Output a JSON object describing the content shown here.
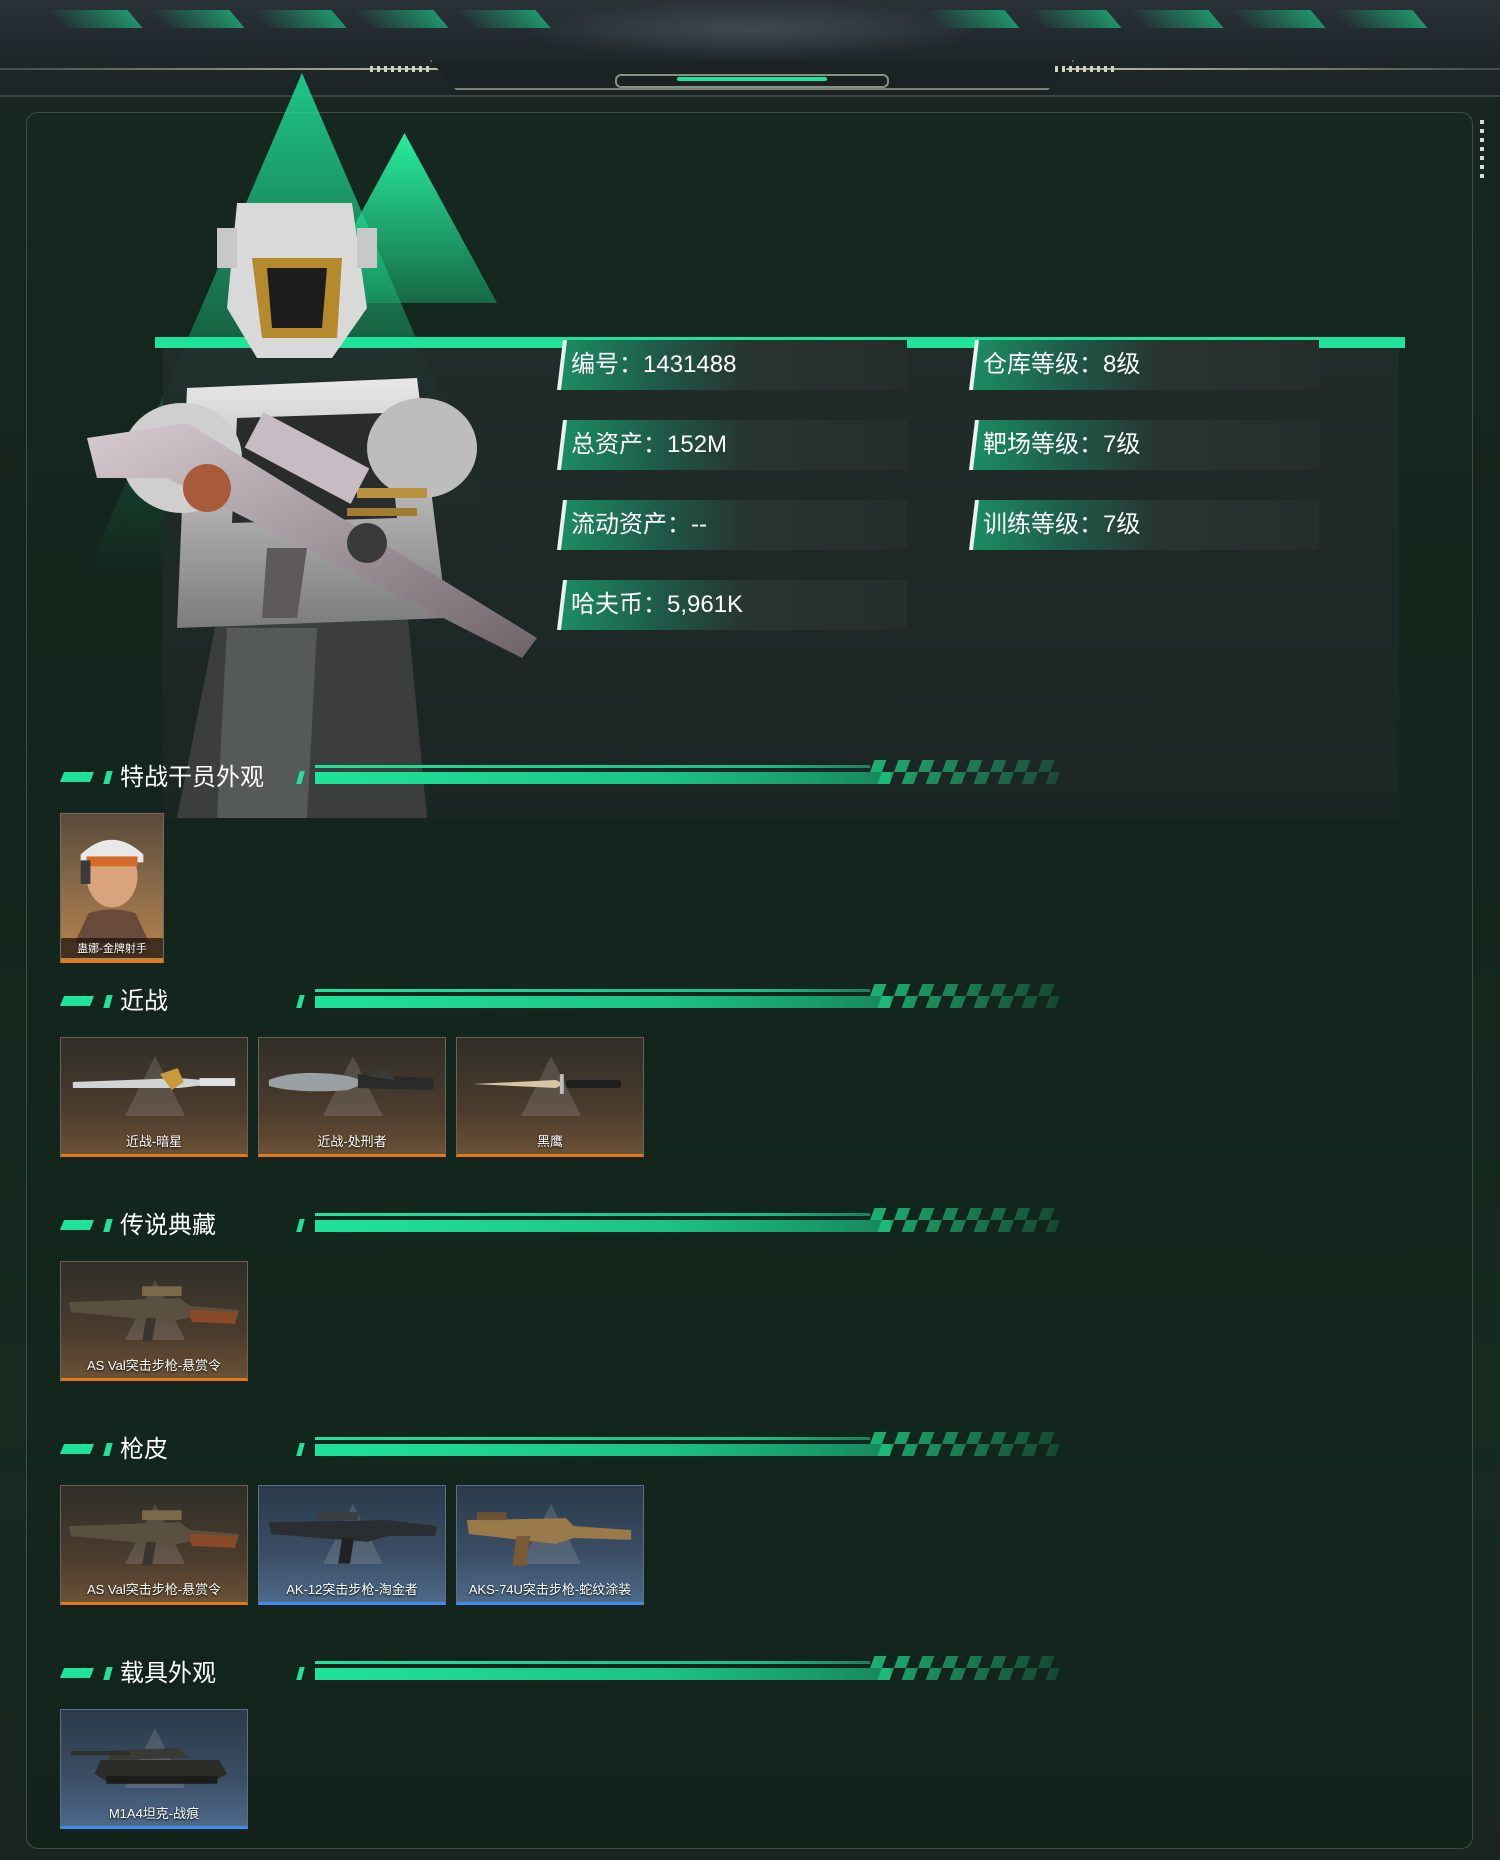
{
  "stats": {
    "id": "编号：1431488",
    "total_assets": "总资产：152M",
    "liquid_assets": "流动资产：--",
    "havoc_coins": "哈夫币：5,961K",
    "warehouse_level": "仓库等级：8级",
    "range_level": "靶场等级：7级",
    "training_level": "训练等级：7级"
  },
  "sections": {
    "operator": {
      "title": "特战干员外观",
      "items": [
        "蛊娜-金牌射手"
      ]
    },
    "melee": {
      "title": "近战",
      "items": [
        "近战-暗星",
        "近战-处刑者",
        "黑鹰"
      ]
    },
    "legendary": {
      "title": "传说典藏",
      "items": [
        "AS Val突击步枪-悬赏令"
      ]
    },
    "gun_skins": {
      "title": "枪皮",
      "items": [
        "AS Val突击步枪-悬赏令",
        "AK-12突击步枪-淘金者",
        "AKS-74U突击步枪-蛇纹涂装"
      ]
    },
    "vehicle": {
      "title": "载具外观",
      "items": [
        "M1A4坦克-战痕"
      ]
    }
  },
  "colors": {
    "accent": "#1fe39a",
    "rarity_orange": "#e4781e",
    "rarity_blue": "#3e8ef0",
    "background": "#14231b"
  }
}
